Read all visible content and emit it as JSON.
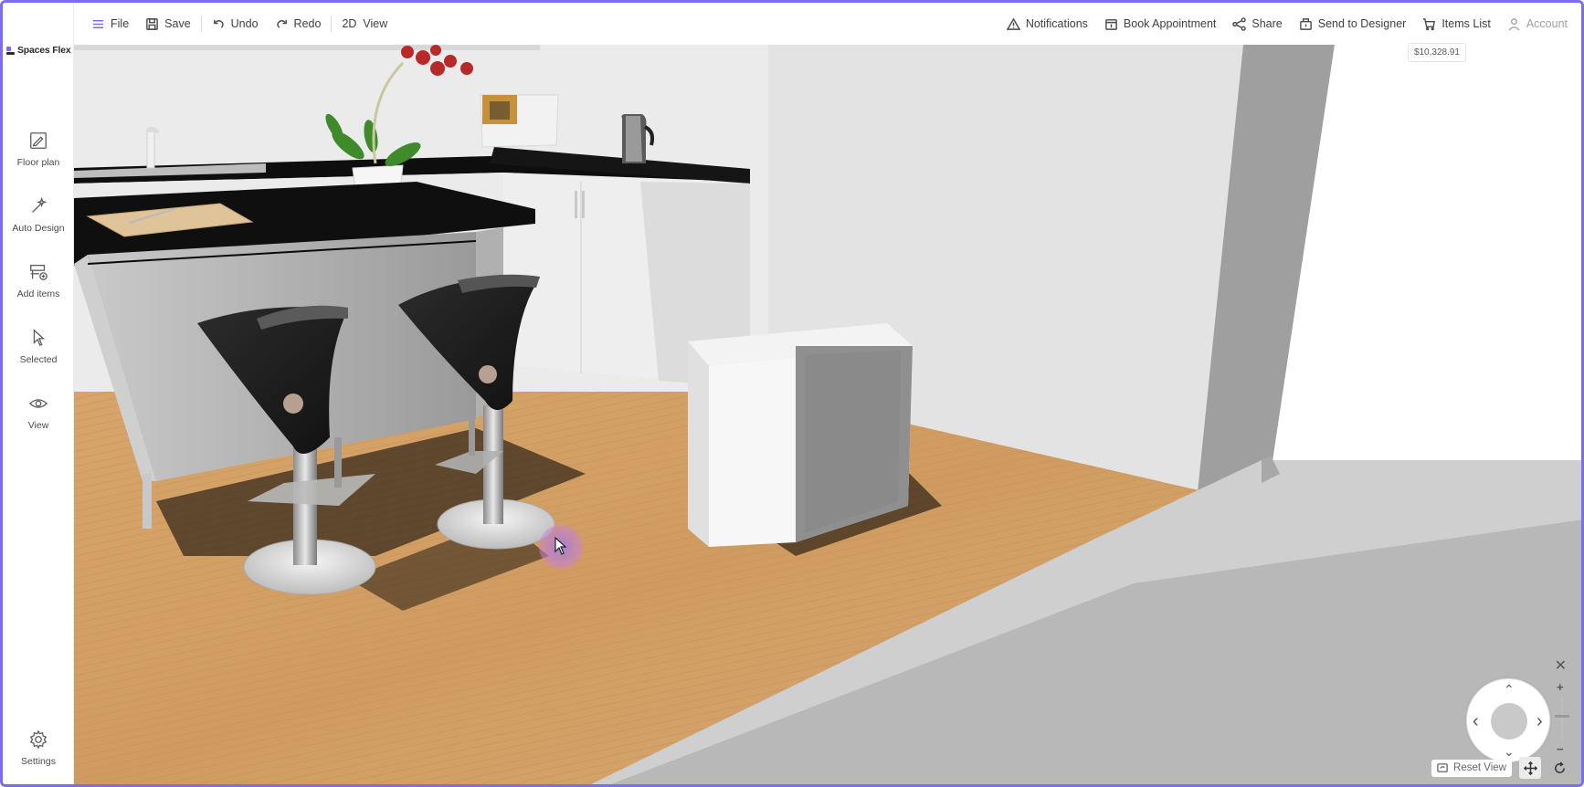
{
  "brand": {
    "name": "Spaces Flex",
    "accent": "#7b6cf0"
  },
  "toolbar": {
    "left": [
      {
        "id": "file",
        "label": "File",
        "icon": "menu-icon"
      },
      {
        "id": "save",
        "label": "Save",
        "icon": "save-icon"
      },
      {
        "id": "undo",
        "label": "Undo",
        "icon": "undo-icon"
      },
      {
        "id": "redo",
        "label": "Redo",
        "icon": "redo-icon"
      },
      {
        "id": "view2d",
        "label": "2D  View",
        "icon": "none"
      }
    ],
    "right": [
      {
        "id": "notifications",
        "label": "Notifications",
        "icon": "warning-icon"
      },
      {
        "id": "book",
        "label": "Book Appointment",
        "icon": "calendar-icon"
      },
      {
        "id": "share",
        "label": "Share",
        "icon": "share-icon"
      },
      {
        "id": "designer",
        "label": "Send to Designer",
        "icon": "designer-icon"
      },
      {
        "id": "items",
        "label": "Items List",
        "icon": "cart-icon"
      },
      {
        "id": "account",
        "label": "Account",
        "icon": "user-icon"
      }
    ]
  },
  "sidebar": {
    "items": [
      {
        "label": "Floor plan",
        "icon": "floor-plan-icon"
      },
      {
        "label": "Auto Design",
        "icon": "magic-wand-icon"
      },
      {
        "label": "Add items",
        "icon": "add-items-icon"
      },
      {
        "label": "Selected",
        "icon": "pointer-icon"
      },
      {
        "label": "View",
        "icon": "eye-icon"
      }
    ],
    "settings_label": "Settings"
  },
  "price": "$10,328.91",
  "controls": {
    "close": "✕",
    "zoom_in": "+",
    "zoom_out": "−",
    "reset_view": "Reset View",
    "arrows": {
      "up": "⌃",
      "down": "⌄",
      "left": "‹",
      "right": "›"
    }
  }
}
